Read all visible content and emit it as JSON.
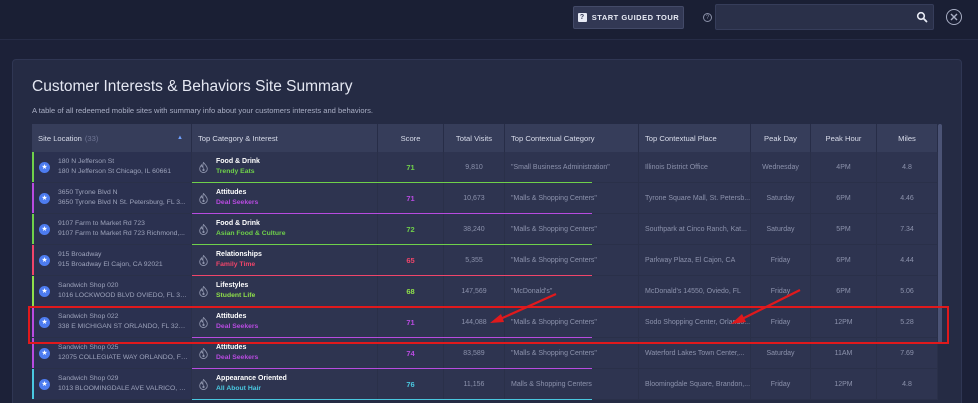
{
  "header": {
    "tour_button_label": "START GUIDED TOUR",
    "tour_icon_glyph": "?",
    "help_glyph": "?",
    "search_value": "",
    "search_placeholder": ""
  },
  "page": {
    "title": "Customer Interests & Behaviors Site Summary",
    "subtitle": "A table of all redeemed mobile sites with summary info about your customers interests and behaviors."
  },
  "table": {
    "columns": {
      "site_location": "Site Location",
      "site_count": "(33)",
      "top_category": "Top Category & Interest",
      "score": "Score",
      "total_visits": "Total Visits",
      "contextual_category": "Top Contextual Category",
      "contextual_place": "Top Contextual Place",
      "peak_day": "Peak Day",
      "peak_hour": "Peak Hour",
      "miles": "Miles"
    },
    "rows": [
      {
        "loc1": "180 N Jefferson St",
        "loc2": "180 N Jefferson St Chicago, IL 60661",
        "cat": "Food & Drink",
        "sub": "Trendy Eats",
        "color": "#6fd04a",
        "score": "71",
        "visits": "9,810",
        "ctx_cat": "\"Small Business Administration\"",
        "ctx_place": "Illinois District Office",
        "day": "Wednesday",
        "hour": "4PM",
        "miles": "4.8"
      },
      {
        "loc1": "3650 Tyrone Blvd N",
        "loc2": "3650 Tyrone Blvd N St. Petersburg, FL 3...",
        "cat": "Attitudes",
        "sub": "Deal Seekers",
        "color": "#b84be0",
        "score": "71",
        "visits": "10,673",
        "ctx_cat": "\"Malls & Shopping Centers\"",
        "ctx_place": "Tyrone Square Mall, St. Petersb...",
        "day": "Saturday",
        "hour": "6PM",
        "miles": "4.46"
      },
      {
        "loc1": "9107 Farm to Market Rd 723",
        "loc2": "9107 Farm to Market Rd 723 Richmond,...",
        "cat": "Food & Drink",
        "sub": "Asian Food & Culture",
        "color": "#6fd04a",
        "score": "72",
        "visits": "38,240",
        "ctx_cat": "\"Malls & Shopping Centers\"",
        "ctx_place": "Southpark at Cinco Ranch, Kat...",
        "day": "Saturday",
        "hour": "5PM",
        "miles": "7.34"
      },
      {
        "loc1": "915 Broadway",
        "loc2": "915 Broadway El Cajon, CA 92021",
        "cat": "Relationships",
        "sub": "Family Time",
        "color": "#f0456a",
        "score": "65",
        "visits": "5,355",
        "ctx_cat": "\"Malls & Shopping Centers\"",
        "ctx_place": "Parkway Plaza, El Cajon, CA",
        "day": "Friday",
        "hour": "6PM",
        "miles": "4.44"
      },
      {
        "loc1": "Sandwich Shop 020",
        "loc2": "1016 LOCKWOOD BLVD OVIEDO, FL 327...",
        "cat": "Lifestyles",
        "sub": "Student Life",
        "color": "#8fe04a",
        "score": "68",
        "visits": "147,569",
        "ctx_cat": "\"McDonald's\"",
        "ctx_place": "McDonald's 14550, Oviedo, FL",
        "day": "Friday",
        "hour": "6PM",
        "miles": "5.06"
      },
      {
        "loc1": "Sandwich Shop 022",
        "loc2": "338 E MICHIGAN ST ORLANDO, FL 32806",
        "cat": "Attitudes",
        "sub": "Deal Seekers",
        "color": "#b84be0",
        "score": "71",
        "visits": "144,088",
        "ctx_cat": "\"Malls & Shopping Centers\"",
        "ctx_place": "Sodo Shopping Center, Orlando...",
        "day": "Friday",
        "hour": "12PM",
        "miles": "5.28"
      },
      {
        "loc1": "Sandwich Shop 025",
        "loc2": "12075 COLLEGIATE WAY ORLANDO, FL 3...",
        "cat": "Attitudes",
        "sub": "Deal Seekers",
        "color": "#b84be0",
        "score": "74",
        "visits": "83,589",
        "ctx_cat": "\"Malls & Shopping Centers\"",
        "ctx_place": "Waterford Lakes Town Center,...",
        "day": "Saturday",
        "hour": "11AM",
        "miles": "7.69"
      },
      {
        "loc1": "Sandwich Shop 029",
        "loc2": "1013 BLOOMINGDALE AVE VALRICO, FL...",
        "cat": "Appearance Oriented",
        "sub": "All About Hair",
        "color": "#4ac8e0",
        "score": "76",
        "visits": "11,156",
        "ctx_cat": "Malls & Shopping Centers",
        "ctx_place": "Bloomingdale Square, Brandon,...",
        "day": "Friday",
        "hour": "12PM",
        "miles": "4.8"
      }
    ]
  },
  "theme": {
    "accent": "#4d7cf0",
    "highlight": "#e0191c"
  }
}
